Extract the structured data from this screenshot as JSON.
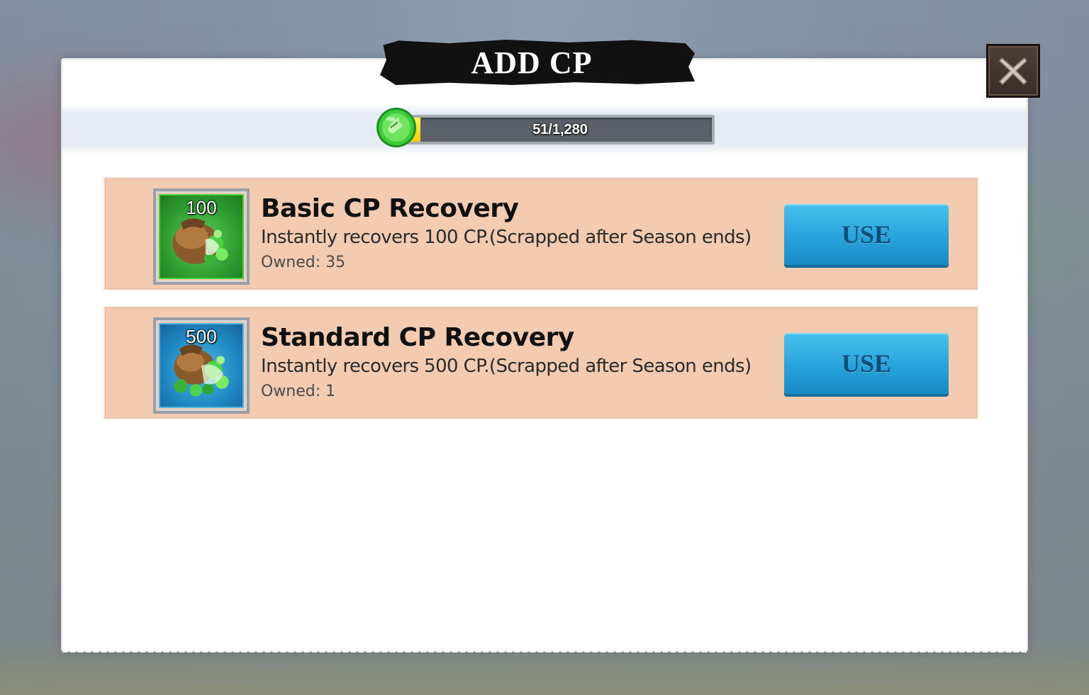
{
  "dialog": {
    "title": "ADD CP",
    "close_icon": "close-x-icon"
  },
  "cp_bar": {
    "icon": "green-gem-icon",
    "current": 51,
    "max": 1280,
    "text": "51/1,280",
    "fill_fraction": 0.04
  },
  "items": [
    {
      "icon": "cp-pouch-green-icon",
      "count": "100",
      "name": "Basic CP Recovery",
      "description": "Instantly recovers 100 CP.(Scrapped after Season ends)",
      "owned": "Owned: 35",
      "button": "USE"
    },
    {
      "icon": "cp-pouch-blue-icon",
      "count": "500",
      "name": "Standard CP Recovery",
      "description": "Instantly recovers 500 CP.(Scrapped after Season ends)",
      "owned": "Owned: 1",
      "button": "USE"
    }
  ],
  "colors": {
    "row_bg": "#f3cbb0",
    "use_button": "#27a3db",
    "bar_fill": "#f1cf00"
  }
}
